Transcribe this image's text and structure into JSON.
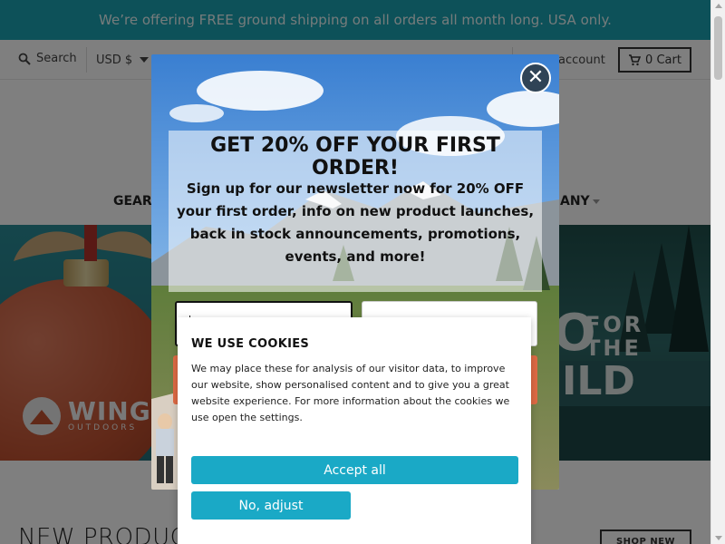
{
  "announcement": "We’re offering FREE ground shipping on all orders all month long. USA only.",
  "header": {
    "search_label": "Search",
    "currency": "USD $",
    "account_label": "account",
    "cart_label": "0 Cart"
  },
  "nav": {
    "items": [
      "GEAR",
      "ANY"
    ]
  },
  "hero": {
    "brand": "WINGO",
    "brand_sub": "OUTDOORS",
    "right_text": {
      "line1": "FOR",
      "line2": "THE",
      "big_letter": "O",
      "big_word": "ILD"
    }
  },
  "section": {
    "title": "NEW PRODUCTS",
    "button": "SHOP NEW"
  },
  "popup": {
    "close_symbol": "✕",
    "title": "GET 20% OFF YOUR FIRST ORDER!",
    "subtitle": "Sign up for our newsletter now for 20% OFF your first order, info on new product launches, back in stock announcements, promotions, events, and more!"
  },
  "cookie": {
    "title": "WE USE COOKIES",
    "text": "We may place these for analysis of our visitor data, to improve our website, show personalised content and to give you a great website experience. For more information about the cookies we use open the settings.",
    "accept_label": "Accept all",
    "adjust_label": "No, adjust"
  },
  "colors": {
    "announcement_bg": "#1aa3b3",
    "cookie_button": "#1aa9c6",
    "close_button": "#2f4356",
    "submit_button": "#e06b45"
  }
}
